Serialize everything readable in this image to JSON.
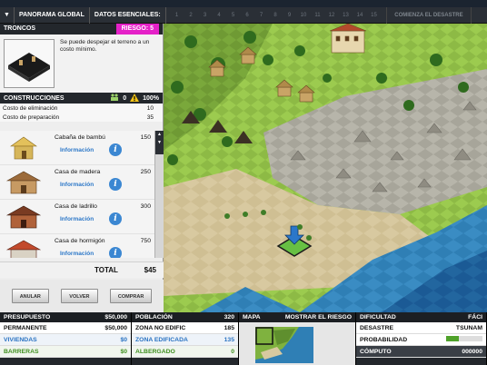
{
  "topbar": {
    "menu_arrow": "▼",
    "panorama_label": "PANORAMA GLOBAL",
    "datos_label": "DATOS ESENCIALES:",
    "turns": [
      "1",
      "2",
      "3",
      "4",
      "5",
      "6",
      "7",
      "8",
      "9",
      "10",
      "11",
      "12",
      "13",
      "14",
      "15"
    ],
    "disaster_label": "COMIENZA EL DESASTRE"
  },
  "terrain": {
    "title": "TRONCOS",
    "risk_label": "RIESGO: 5",
    "description": "Se puede despejar el terreno a un costo mínimo."
  },
  "construction": {
    "title": "CONSTRUCCIONES",
    "count": "0",
    "percent": "100%",
    "cost_rows": [
      {
        "label": "Costo de eliminación",
        "value": "10"
      },
      {
        "label": "Costo de preparación",
        "value": "35"
      }
    ],
    "items": [
      {
        "name": "Cabaña de bambú",
        "info": "Información",
        "price": "150"
      },
      {
        "name": "Casa de madera",
        "info": "Información",
        "price": "250"
      },
      {
        "name": "Casa de ladrillo",
        "info": "Información",
        "price": "300"
      },
      {
        "name": "Casa de hormigón",
        "info": "Información",
        "price": "750"
      }
    ],
    "total_label": "TOTAL",
    "total_value": "$45",
    "buttons": {
      "cancel": "ANULAR",
      "back": "VOLVER",
      "buy": "COMPRAR"
    }
  },
  "bottom": {
    "budget": {
      "header": "PRESUPUESTO",
      "header_value": "$50,000",
      "rows": [
        {
          "label": "PERMANENTE",
          "value": "$50,000"
        },
        {
          "label": "VIVIENDAS",
          "value": "$0"
        },
        {
          "label": "BARRERAS",
          "value": "$0"
        }
      ]
    },
    "population": {
      "header": "POBLACIÓN",
      "header_value": "320",
      "rows": [
        {
          "label": "ZONA NO EDIFIC",
          "value": "185"
        },
        {
          "label": "ZONA EDIFICADA",
          "value": "135"
        },
        {
          "label": "ALBERGADO",
          "value": "0"
        }
      ]
    },
    "map": {
      "header": "MAPA",
      "risk_label": "MOSTRAR EL RIESGO"
    },
    "difficulty": {
      "header": "DIFICULTAD",
      "header_value": "FÁCI",
      "rows": [
        {
          "label": "DESASTRE",
          "value": "TSUNAM"
        },
        {
          "label": "PROBABILIDAD",
          "value": ""
        },
        {
          "label": "CÓMPUTO",
          "value": "000000"
        }
      ]
    }
  },
  "colors": {
    "risk_badge": "#e521c8",
    "info_blue": "#2d78c8",
    "green_row": "#3f8f1f",
    "blue_row": "#2a73c2"
  }
}
